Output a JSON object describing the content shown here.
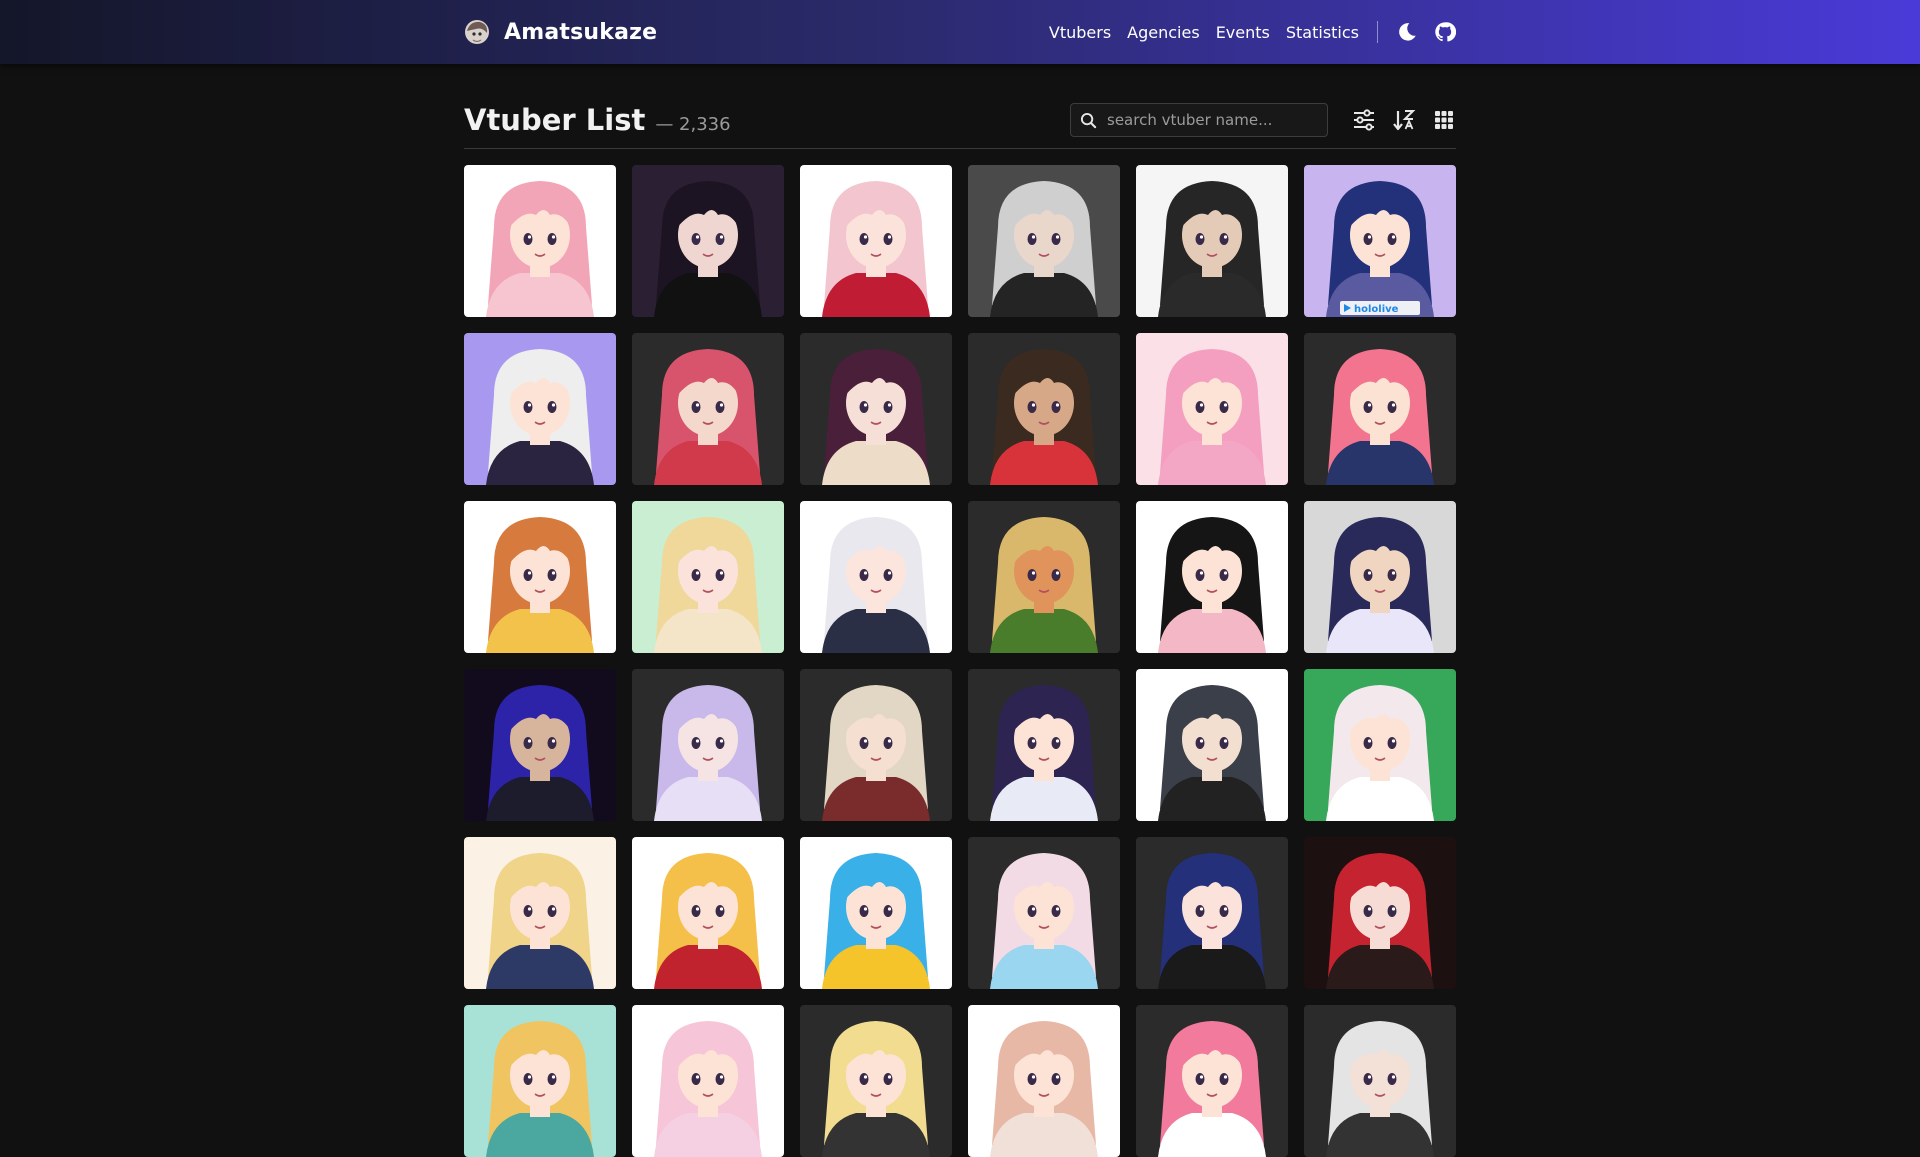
{
  "nav": {
    "brand": "Amatsukaze",
    "links": [
      "Vtubers",
      "Agencies",
      "Events",
      "Statistics"
    ]
  },
  "header": {
    "title": "Vtuber List",
    "count": "— 2,336",
    "search_placeholder": "search vtuber name..."
  },
  "badge": "hololive",
  "colors": {
    "background": "#111111",
    "navbar_gradient": [
      "#141629",
      "#4a3ad8"
    ],
    "card_dark": "#2a2a2a"
  },
  "cards": [
    {
      "bg": "#ffffff",
      "hair": "#f2a5b6",
      "face": "#fde3d5",
      "outfit": "#f7c5cf"
    },
    {
      "bg": "#2b1f33",
      "hair": "#1c1422",
      "face": "#f0d6d0",
      "outfit": "#111111"
    },
    {
      "bg": "#ffffff",
      "hair": "#f3c6cf",
      "face": "#fbe2da",
      "outfit": "#c01d35"
    },
    {
      "bg": "#4a4a4a",
      "hair": "#cfcfcf",
      "face": "#e9d7cc",
      "outfit": "#242424"
    },
    {
      "bg": "#f5f5f5",
      "hair": "#262626",
      "face": "#e4cbb8",
      "outfit": "#2a2a2a"
    },
    {
      "bg": "#c8b5f0",
      "hair": "#23307a",
      "face": "#fde3d5",
      "outfit": "#5a5aa0"
    },
    {
      "bg": "#a898f0",
      "hair": "#eeeeee",
      "face": "#fde3d5",
      "outfit": "#2a2440"
    },
    {
      "bg": "#2b2b2b",
      "hair": "#d8546c",
      "face": "#f3d8cb",
      "outfit": "#d03a4a"
    },
    {
      "bg": "#2b2b2b",
      "hair": "#4a1f3a",
      "face": "#f6dfd7",
      "outfit": "#ecdcc8"
    },
    {
      "bg": "#2b2b2b",
      "hair": "#3a2a20",
      "face": "#d6a888",
      "outfit": "#d8333a"
    },
    {
      "bg": "#fbe0e8",
      "hair": "#f59fc0",
      "face": "#fde3d5",
      "outfit": "#f4a7c4"
    },
    {
      "bg": "#2b2b2b",
      "hair": "#f2748f",
      "face": "#fbe2d2",
      "outfit": "#27356b"
    },
    {
      "bg": "#ffffff",
      "hair": "#d77a3d",
      "face": "#fde3d5",
      "outfit": "#f2c24a"
    },
    {
      "bg": "#c9eed2",
      "hair": "#f0d79a",
      "face": "#fbe2da",
      "outfit": "#f4e4c8"
    },
    {
      "bg": "#ffffff",
      "hair": "#e8e8ee",
      "face": "#fbe5dc",
      "outfit": "#2a2f45"
    },
    {
      "bg": "#2b2b2b",
      "hair": "#d9b86b",
      "face": "#e0935a",
      "outfit": "#4a7d2b"
    },
    {
      "bg": "#ffffff",
      "hair": "#151515",
      "face": "#fde3d5",
      "outfit": "#f3b7c6"
    },
    {
      "bg": "#d8d8d8",
      "hair": "#2a2a5a",
      "face": "#f0d5c0",
      "outfit": "#e8e6f8"
    },
    {
      "bg": "#120b1e",
      "hair": "#2c23a8",
      "face": "#d7b49c",
      "outfit": "#1c1c2c"
    },
    {
      "bg": "#2b2b2b",
      "hair": "#c9b8ea",
      "face": "#f6e4e4",
      "outfit": "#e6dff5"
    },
    {
      "bg": "#2b2b2b",
      "hair": "#e2d7c4",
      "face": "#f4dfd0",
      "outfit": "#7a2b2b"
    },
    {
      "bg": "#2b2b2b",
      "hair": "#2e2452",
      "face": "#fde3d5",
      "outfit": "#e8eaf5"
    },
    {
      "bg": "#ffffff",
      "hair": "#3b3f4a",
      "face": "#f2dfd0",
      "outfit": "#222222"
    },
    {
      "bg": "#37a85a",
      "hair": "#f3e8ec",
      "face": "#fde3d5",
      "outfit": "#ffffff"
    },
    {
      "bg": "#fbf1e4",
      "hair": "#f0d48a",
      "face": "#fde3d5",
      "outfit": "#2e3a66"
    },
    {
      "bg": "#ffffff",
      "hair": "#f5c04a",
      "face": "#fde3d5",
      "outfit": "#c0222e"
    },
    {
      "bg": "#ffffff",
      "hair": "#3ab0e8",
      "face": "#fde3d5",
      "outfit": "#f5c42a"
    },
    {
      "bg": "#2b2b2b",
      "hair": "#f3dbe6",
      "face": "#fde3d5",
      "outfit": "#9ad6ef"
    },
    {
      "bg": "#2b2b2b",
      "hair": "#24307a",
      "face": "#fbe2da",
      "outfit": "#1a1a1a"
    },
    {
      "bg": "#1c1010",
      "hair": "#c4232f",
      "face": "#f6dcd4",
      "outfit": "#2a1a1a"
    },
    {
      "bg": "#a8e2d6",
      "hair": "#f0c460",
      "face": "#fde3d5",
      "outfit": "#4aa8a0"
    },
    {
      "bg": "#ffffff",
      "hair": "#f6c6d8",
      "face": "#fde3d5",
      "outfit": "#f4d0e2"
    },
    {
      "bg": "#2b2b2b",
      "hair": "#f2dc90",
      "face": "#fde3d5",
      "outfit": "#333333"
    },
    {
      "bg": "#ffffff",
      "hair": "#e8b8a6",
      "face": "#fde3d5",
      "outfit": "#f0e0d8"
    },
    {
      "bg": "#2b2b2b",
      "hair": "#f27a9c",
      "face": "#fde3d5",
      "outfit": "#ffffff"
    },
    {
      "bg": "#2b2b2b",
      "hair": "#e4e4e4",
      "face": "#f3e0d6",
      "outfit": "#333333"
    }
  ]
}
